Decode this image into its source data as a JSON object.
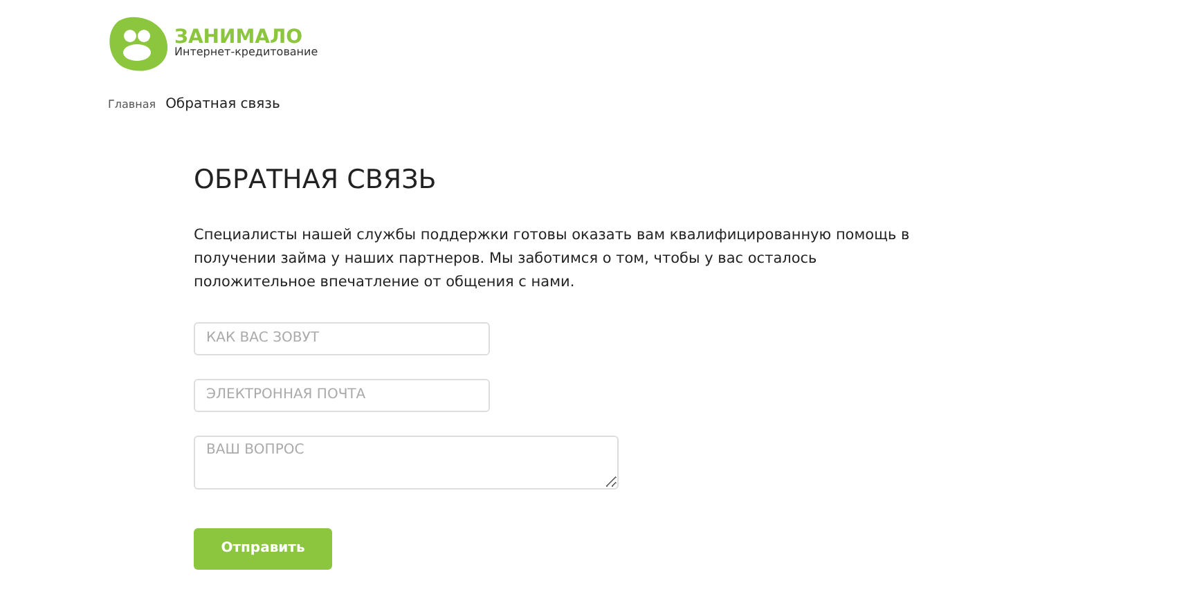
{
  "logo": {
    "name": "ЗАНИМАЛО",
    "tagline": "Интернет-кредитование"
  },
  "breadcrumb": [
    {
      "label": "Главная",
      "current": false
    },
    {
      "label": "Обратная связь",
      "current": true
    }
  ],
  "title": "ОБРАТНАЯ СВЯЗЬ",
  "description": "Специалисты нашей службы поддержки готовы оказать вам квалифицированную помощь в получении займа у наших партнеров. Мы заботимся о том, чтобы у вас осталось положительное впечатление от общения с нами.",
  "form": {
    "fields": [
      {
        "kind": "input",
        "placeholder": "КАК ВАС ЗОВУТ"
      },
      {
        "kind": "input",
        "placeholder": "ЭЛЕКТРОННАЯ ПОЧТА"
      },
      {
        "kind": "textarea",
        "placeholder": "ВАШ ВОПРОС"
      }
    ],
    "submit": "Отправить"
  }
}
